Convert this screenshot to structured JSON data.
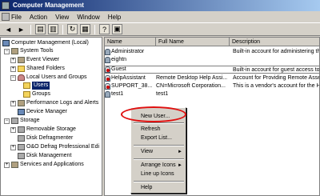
{
  "window": {
    "title": "Computer Management"
  },
  "menu": [
    "File",
    "Action",
    "View",
    "Window",
    "Help"
  ],
  "tree": [
    {
      "label": "Computer Management (Local)",
      "icon": "computer-icon"
    },
    {
      "label": "System Tools",
      "icon": "tools-icon"
    },
    {
      "label": "Event Viewer",
      "icon": "event-viewer-icon"
    },
    {
      "label": "Shared Folders",
      "icon": "folder-icon"
    },
    {
      "label": "Local Users and Groups",
      "icon": "users-groups-icon"
    },
    {
      "label": "Users",
      "icon": "folder-icon",
      "selected": true
    },
    {
      "label": "Groups",
      "icon": "folder-icon"
    },
    {
      "label": "Performance Logs and Alerts",
      "icon": "performance-icon"
    },
    {
      "label": "Device Manager",
      "icon": "device-manager-icon"
    },
    {
      "label": "Storage",
      "icon": "storage-icon"
    },
    {
      "label": "Removable Storage",
      "icon": "removable-storage-icon"
    },
    {
      "label": "Disk Defragmenter",
      "icon": "defrag-icon"
    },
    {
      "label": "O&O Defrag Professional Edi",
      "icon": "defrag-icon"
    },
    {
      "label": "Disk Management",
      "icon": "disk-icon"
    },
    {
      "label": "Services and Applications",
      "icon": "services-icon"
    }
  ],
  "list": {
    "columns": [
      "Name",
      "Full Name",
      "Description"
    ],
    "rows": [
      {
        "name": "Administrator",
        "full_name": "",
        "description": "Built-in account for administering th",
        "disabled": false
      },
      {
        "name": "eightn",
        "full_name": "",
        "description": "",
        "disabled": false
      },
      {
        "name": "Guest",
        "full_name": "",
        "description": "Built-in account for guest access to",
        "disabled": true
      },
      {
        "name": "HelpAssistant",
        "full_name": "Remote Desktop Help Assi...",
        "description": "Account for Providing Remote Asse",
        "disabled": true
      },
      {
        "name": "SUPPORT_38...",
        "full_name": "CN=Microsoft Corporation...",
        "description": "This is a vendor's account for the H",
        "disabled": true
      },
      {
        "name": "test1",
        "full_name": "test1",
        "description": "",
        "disabled": false
      }
    ]
  },
  "context_menu": {
    "new_user": "New User...",
    "refresh": "Refresh",
    "export": "Export List...",
    "view": "View",
    "arrange": "Arrange Icons",
    "line_up": "Line up Icons",
    "help": "Help"
  },
  "highlight_color": "#e01010"
}
